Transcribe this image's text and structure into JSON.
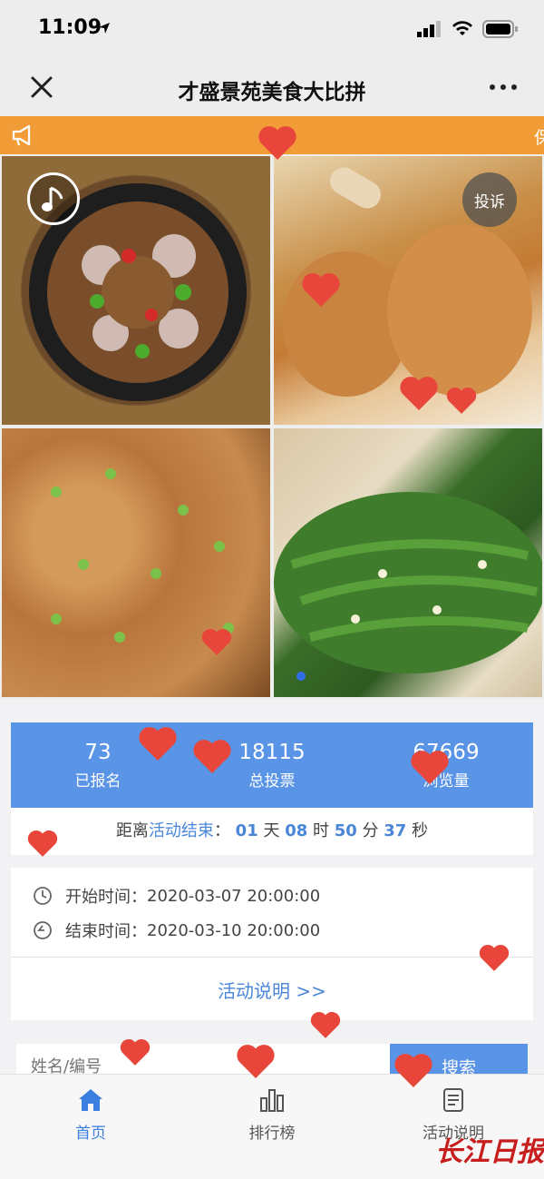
{
  "status_bar": {
    "time": "11:09"
  },
  "nav": {
    "title": "才盛景苑美食大比拼"
  },
  "notice": {
    "text": "保"
  },
  "gallery": {
    "complain_label": "投诉"
  },
  "stats": [
    {
      "value": "73",
      "label": "已报名"
    },
    {
      "value": "18115",
      "label": "总投票"
    },
    {
      "value": "67669",
      "label": "浏览量"
    }
  ],
  "countdown": {
    "prefix": "距离",
    "event_label": "活动结束",
    "colon": "：",
    "days": "01",
    "days_unit": "天",
    "hours": "08",
    "hours_unit": "时",
    "minutes": "50",
    "minutes_unit": "分",
    "seconds": "37",
    "seconds_unit": "秒"
  },
  "schedule": {
    "start_label": "开始时间：",
    "start_value": "2020-03-07 20:00:00",
    "end_label": "结束时间：",
    "end_value": "2020-03-10 20:00:00",
    "description_link": "活动说明 >>"
  },
  "search": {
    "placeholder": "姓名/编号",
    "button_label": "搜索"
  },
  "tabs": [
    {
      "label": "首页",
      "icon": "home-icon",
      "active": true
    },
    {
      "label": "排行榜",
      "icon": "bar-chart-icon",
      "active": false
    },
    {
      "label": "活动说明",
      "icon": "document-icon",
      "active": false
    }
  ],
  "watermark": "长江日报",
  "colors": {
    "accent_blue": "#5a94e6",
    "notice_orange": "#f29c38",
    "heart_red": "#e8463a"
  }
}
